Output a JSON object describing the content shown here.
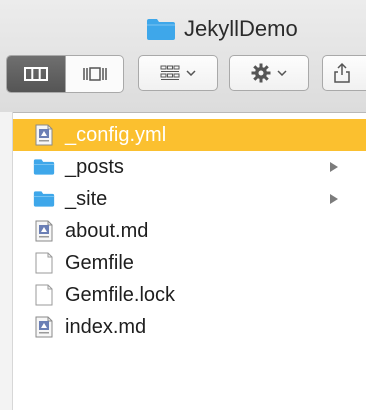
{
  "window": {
    "title": "JekyllDemo"
  },
  "toolbar": {
    "view_buttons": [
      {
        "name": "column-view",
        "selected": true
      },
      {
        "name": "cover-flow-view",
        "selected": false
      }
    ],
    "arrange_icon": "grid-arrange-icon",
    "action_icon": "gear-icon",
    "share_icon": "share-icon"
  },
  "files": [
    {
      "label": "_config.yml",
      "kind": "document",
      "selected": true,
      "has_children": false
    },
    {
      "label": "_posts",
      "kind": "folder",
      "selected": false,
      "has_children": true
    },
    {
      "label": "_site",
      "kind": "folder",
      "selected": false,
      "has_children": true
    },
    {
      "label": "about.md",
      "kind": "document",
      "selected": false,
      "has_children": false
    },
    {
      "label": "Gemfile",
      "kind": "blank",
      "selected": false,
      "has_children": false
    },
    {
      "label": "Gemfile.lock",
      "kind": "blank",
      "selected": false,
      "has_children": false
    },
    {
      "label": "index.md",
      "kind": "document",
      "selected": false,
      "has_children": false
    }
  ],
  "colors": {
    "selection": "#fbc02f",
    "folder": "#3ea7ea"
  }
}
